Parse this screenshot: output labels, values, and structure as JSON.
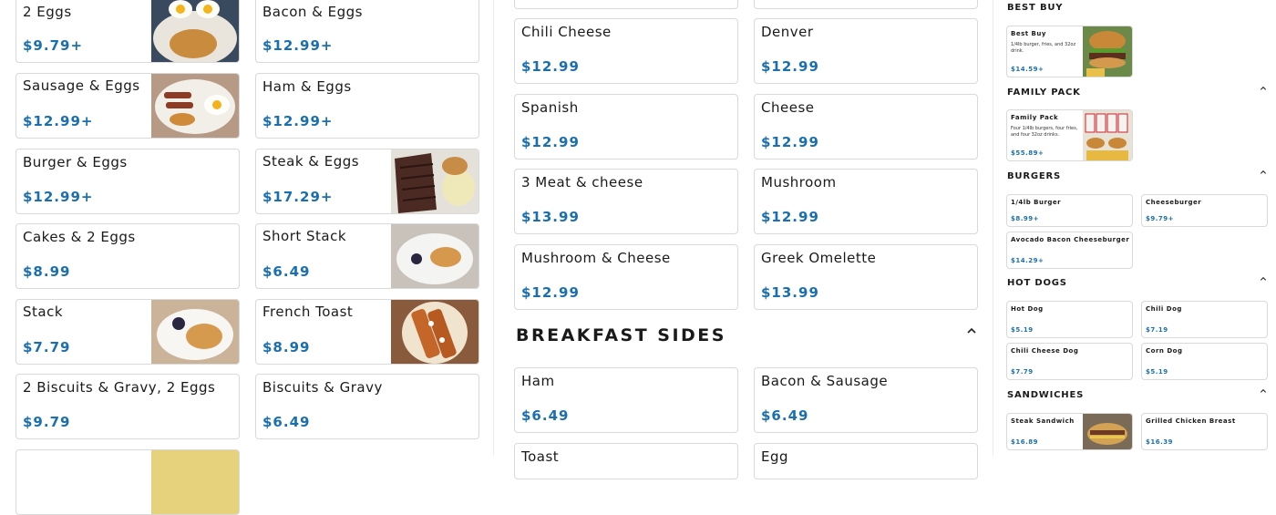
{
  "breakfast_col1": [
    {
      "name": "2 Eggs",
      "price": "$9.79+"
    },
    {
      "name": "Sausage & Eggs",
      "price": "$12.99+"
    },
    {
      "name": "Burger & Eggs",
      "price": "$12.99+"
    },
    {
      "name": "Cakes & 2 Eggs",
      "price": "$8.99"
    },
    {
      "name": "Stack",
      "price": "$7.79"
    },
    {
      "name": "2 Biscuits & Gravy, 2 Eggs",
      "price": "$9.79"
    }
  ],
  "breakfast_col2": [
    {
      "name": "Bacon & Eggs",
      "price": "$12.99+"
    },
    {
      "name": "Ham & Eggs",
      "price": "$12.99+"
    },
    {
      "name": "Steak & Eggs",
      "price": "$17.29+"
    },
    {
      "name": "Short Stack",
      "price": "$6.49"
    },
    {
      "name": "French Toast",
      "price": "$8.99"
    },
    {
      "name": "Biscuits & Gravy",
      "price": "$6.49"
    }
  ],
  "omelettes_col1": [
    {
      "name": "Chili Cheese",
      "price": "$12.99"
    },
    {
      "name": "Spanish",
      "price": "$12.99"
    },
    {
      "name": "3 Meat & cheese",
      "price": "$13.99"
    },
    {
      "name": "Mushroom & Cheese",
      "price": "$12.99"
    }
  ],
  "omelettes_col2": [
    {
      "name": "Denver",
      "price": "$12.99"
    },
    {
      "name": "Cheese",
      "price": "$12.99"
    },
    {
      "name": "Mushroom",
      "price": "$12.99"
    },
    {
      "name": "Greek Omelette",
      "price": "$13.99"
    }
  ],
  "breakfast_sides": {
    "title": "BREAKFAST SIDES",
    "items": [
      {
        "name": "Ham",
        "price": "$6.49"
      },
      {
        "name": "Bacon & Sausage",
        "price": "$6.49"
      },
      {
        "name": "Toast",
        "price": ""
      },
      {
        "name": "Egg",
        "price": ""
      }
    ]
  },
  "right_sections": {
    "best_buy": {
      "title": "BEST BUY",
      "item": {
        "name": "Best Buy",
        "desc": "1/4lb burger, fries, and 32oz drink.",
        "price": "$14.59+"
      }
    },
    "family_pack": {
      "title": "FAMILY PACK",
      "item": {
        "name": "Family Pack",
        "desc": "Four 1/4lb burgers, four fries, and four 32oz drinks.",
        "price": "$55.89+"
      }
    },
    "burgers": {
      "title": "BURGERS",
      "items": [
        {
          "name": "1/4lb Burger",
          "price": "$8.99+"
        },
        {
          "name": "Cheeseburger",
          "price": "$9.79+"
        },
        {
          "name": "Avocado Bacon Cheeseburger",
          "price": "$14.29+"
        }
      ]
    },
    "hot_dogs": {
      "title": "HOT DOGS",
      "items": [
        {
          "name": "Hot Dog",
          "price": "$5.19"
        },
        {
          "name": "Chili Dog",
          "price": "$7.19"
        },
        {
          "name": "Chili Cheese Dog",
          "price": "$7.79"
        },
        {
          "name": "Corn Dog",
          "price": "$5.19"
        }
      ]
    },
    "sandwiches": {
      "title": "SANDWICHES",
      "items": [
        {
          "name": "Steak Sandwich",
          "price": "$16.89"
        },
        {
          "name": "Grilled Chicken Breast",
          "price": "$16.39"
        }
      ]
    }
  },
  "icons": {
    "collapse": "chevron-up-icon"
  },
  "colors": {
    "price": "#1a6fb0",
    "border": "#d9d9d9"
  }
}
